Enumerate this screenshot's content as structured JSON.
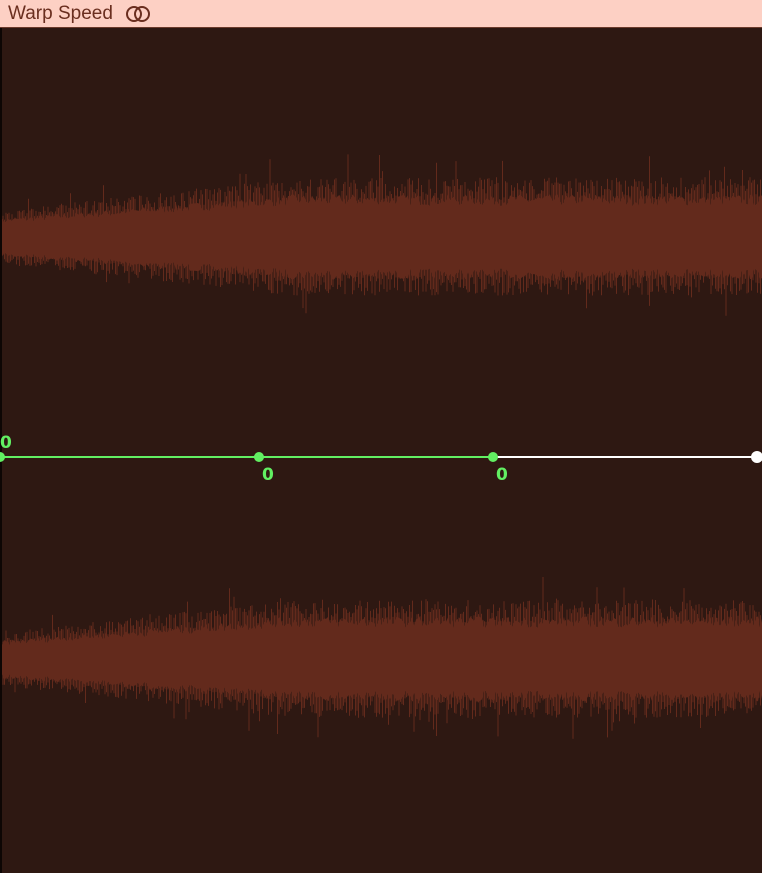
{
  "region": {
    "title": "Warp Speed",
    "stereo_icon": "stereo-link-icon"
  },
  "automation": {
    "point_values": [
      "0",
      "0",
      "0"
    ],
    "active_color": "#62ef62",
    "inactive_color": "#ffffff"
  },
  "colors": {
    "header_bg": "#fdd0c4",
    "title_text": "#6a2e1f",
    "track_bg": "#2e1812",
    "waveform": "#632a1c"
  }
}
